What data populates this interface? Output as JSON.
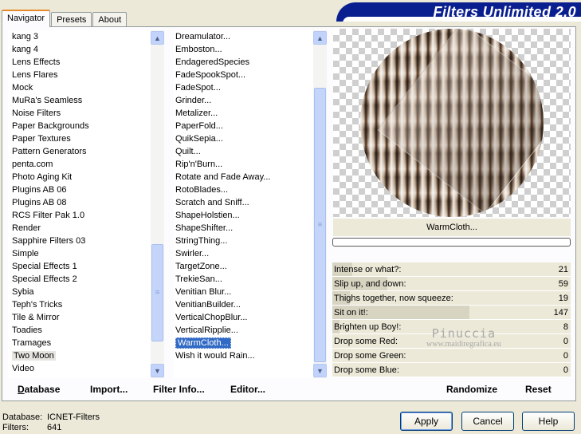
{
  "tabs": [
    {
      "label": "Navigator",
      "active": true
    },
    {
      "label": "Presets",
      "active": false
    },
    {
      "label": "About",
      "active": false
    }
  ],
  "banner": {
    "title": "Filters Unlimited 2.0"
  },
  "categories": {
    "items": [
      "kang 3",
      "kang 4",
      "Lens Effects",
      "Lens Flares",
      "Mock",
      "MuRa's Seamless",
      "Noise Filters",
      "Paper Backgrounds",
      "Paper Textures",
      "Pattern Generators",
      "penta.com",
      "Photo Aging Kit",
      "Plugins AB 06",
      "Plugins AB 08",
      "RCS Filter Pak 1.0",
      "Render",
      "Sapphire Filters 03",
      "Simple",
      "Special Effects 1",
      "Special Effects 2",
      "Sybia",
      "Teph's Tricks",
      "Tile & Mirror",
      "Toadies",
      "Tramages",
      "Two Moon",
      "Video"
    ],
    "selected": "Two Moon"
  },
  "filters": {
    "items": [
      "Dreamulator...",
      "Emboston...",
      "EndageredSpecies",
      "FadeSpookSpot...",
      "FadeSpot...",
      "Grinder...",
      "Metalizer...",
      "PaperFold...",
      "QuikSepia...",
      "Quilt...",
      "Rip'n'Burn...",
      "Rotate and Fade Away...",
      "RotoBlades...",
      "Scratch and Sniff...",
      "ShapeHolstien...",
      "ShapeShifter...",
      "StringThing...",
      "Swirler...",
      "TargetZone...",
      "TrekieSan...",
      "Venitian Blur...",
      "VenitianBuilder...",
      "VerticalChopBlur...",
      "VerticalRipplie...",
      "WarmCloth...",
      "Wish it would Rain..."
    ],
    "selected": "WarmCloth..."
  },
  "preview": {
    "filter_name": "WarmCloth...",
    "progress": 0
  },
  "sliders": [
    {
      "label": "Intense or what?:",
      "value": 21
    },
    {
      "label": "Slip up, and down:",
      "value": 59
    },
    {
      "label": "Thighs together, now squeeze:",
      "value": 19
    },
    {
      "label": "Sit on it!:",
      "value": 147
    },
    {
      "label": "Brighten up Boy!:",
      "value": 8
    },
    {
      "label": "Drop some Red:",
      "value": 0
    },
    {
      "label": "Drop some Green:",
      "value": 0
    },
    {
      "label": "Drop some Blue:",
      "value": 0
    }
  ],
  "watermark": {
    "line1": "Pinuccia",
    "line2": "www.maidiregrafica.eu"
  },
  "panel_buttons": {
    "database": "Database",
    "import": "Import...",
    "filter_info": "Filter Info...",
    "editor": "Editor...",
    "randomize": "Randomize",
    "reset": "Reset"
  },
  "footer": {
    "database_label": "Database:",
    "database_value": "ICNET-Filters",
    "filters_label": "Filters:",
    "filters_value": "641"
  },
  "dialog_buttons": {
    "apply": "Apply",
    "cancel": "Cancel",
    "help": "Help"
  },
  "icons": {
    "scroll_up": "chevron-up-icon",
    "scroll_down": "chevron-down-icon"
  },
  "colors": {
    "banner": "#0a1f8f",
    "selection": "#316ac5",
    "tab_accent": "#e68b2c"
  }
}
